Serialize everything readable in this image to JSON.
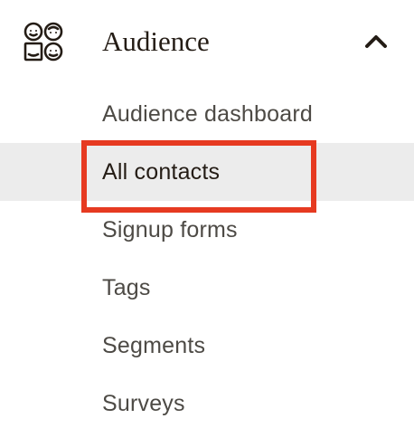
{
  "section": {
    "title": "Audience",
    "icon": "audience-icon",
    "toggle_icon": "chevron-up-icon",
    "expanded": true
  },
  "nav": {
    "items": [
      {
        "label": "Audience dashboard",
        "active": false
      },
      {
        "label": "All contacts",
        "active": true
      },
      {
        "label": "Signup forms",
        "active": false
      },
      {
        "label": "Tags",
        "active": false
      },
      {
        "label": "Segments",
        "active": false
      },
      {
        "label": "Surveys",
        "active": false
      }
    ]
  },
  "annotation": {
    "highlight_color": "#e63a21",
    "highlighted_item": "All contacts"
  },
  "colors": {
    "text": "#241c15",
    "muted_text": "#4d4a45",
    "active_background": "#ececec"
  }
}
